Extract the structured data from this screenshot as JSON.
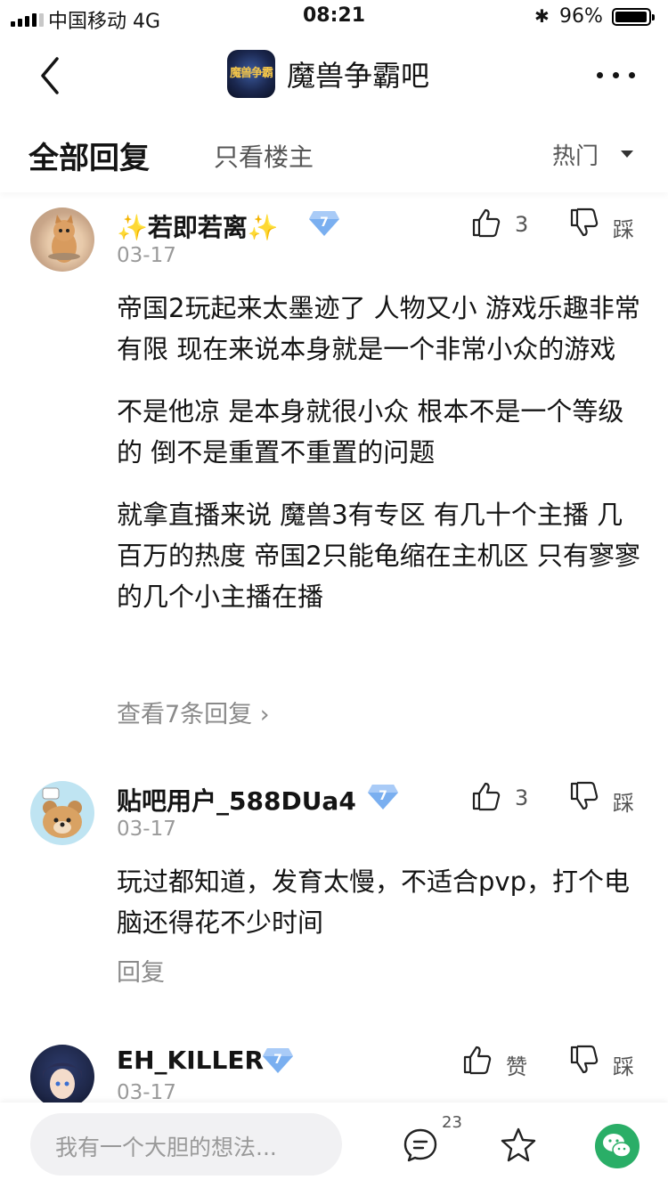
{
  "status_bar": {
    "carrier": "中国移动  4G",
    "time": "08:21",
    "battery": "96%",
    "battery_level": 0.96
  },
  "nav": {
    "title": "魔兽争霸吧",
    "logo_text": "魔兽争霸"
  },
  "filter": {
    "all_replies": "全部回复",
    "only_op": "只看楼主",
    "sort": "热门"
  },
  "posts": [
    {
      "username": "✨若即若离✨",
      "level": "7",
      "date": "03-17",
      "likes": "3",
      "dislike_label": "踩",
      "paragraphs": [
        "帝国2玩起来太墨迹了 人物又小 游戏乐趣非常有限 现在来说本身就是一个非常小众的游戏",
        "不是他凉 是本身就很小众 根本不是一个等级的 倒不是重置不重置的问题",
        "就拿直播来说 魔兽3有专区 有几十个主播 几百万的热度 帝国2只能龟缩在主机区 只有寥寥的几个小主播在播"
      ],
      "view_replies": "查看7条回复"
    },
    {
      "username": "贴吧用户_588DUa4",
      "level": "7",
      "date": "03-17",
      "likes": "3",
      "dislike_label": "踩",
      "paragraphs": [
        "玩过都知道，发育太慢，不适合pvp，打个电脑还得花不少时间"
      ],
      "reply_label": "回复"
    },
    {
      "username": "EH_KILLER",
      "level": "7",
      "date": "03-17",
      "like_label": "赞",
      "dislike_label": "踩"
    }
  ],
  "bottom": {
    "input_placeholder": "我有一个大胆的想法...",
    "comment_count": "23"
  }
}
